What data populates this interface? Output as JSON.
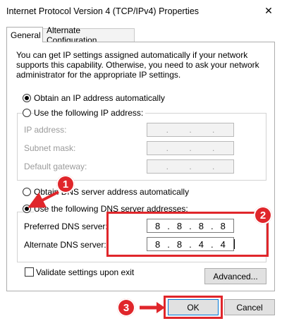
{
  "window": {
    "title": "Internet Protocol Version 4 (TCP/IPv4) Properties",
    "close_glyph": "✕"
  },
  "tabs": [
    {
      "label": "General"
    },
    {
      "label": "Alternate Configuration"
    }
  ],
  "description": "You can get IP settings assigned automatically if your network supports this capability. Otherwise, you need to ask your network administrator for the appropriate IP settings.",
  "ip_section": {
    "auto_label": "Obtain an IP address automatically",
    "manual_label": "Use the following IP address:",
    "fields": [
      {
        "label": "IP address:",
        "dots": [
          ".",
          ".",
          "."
        ]
      },
      {
        "label": "Subnet mask:",
        "dots": [
          ".",
          ".",
          "."
        ]
      },
      {
        "label": "Default gateway:",
        "dots": [
          ".",
          ".",
          "."
        ]
      }
    ]
  },
  "dns_section": {
    "auto_label": "Obtain DNS server address automatically",
    "manual_label": "Use the following DNS server addresses:",
    "preferred": {
      "label": "Preferred DNS server:",
      "octets": [
        "8",
        "8",
        "8",
        "8"
      ]
    },
    "alternate": {
      "label": "Alternate DNS server:",
      "octets": [
        "8",
        "8",
        "4",
        "4"
      ]
    },
    "dot": "."
  },
  "validate_label": "Validate settings upon exit",
  "buttons": {
    "advanced": "Advanced...",
    "ok": "OK",
    "cancel": "Cancel"
  },
  "annotations": {
    "step1": "1",
    "step2": "2",
    "step3": "3"
  },
  "colors": {
    "annotation_red": "#e0262b",
    "default_button_border": "#0078d7"
  }
}
